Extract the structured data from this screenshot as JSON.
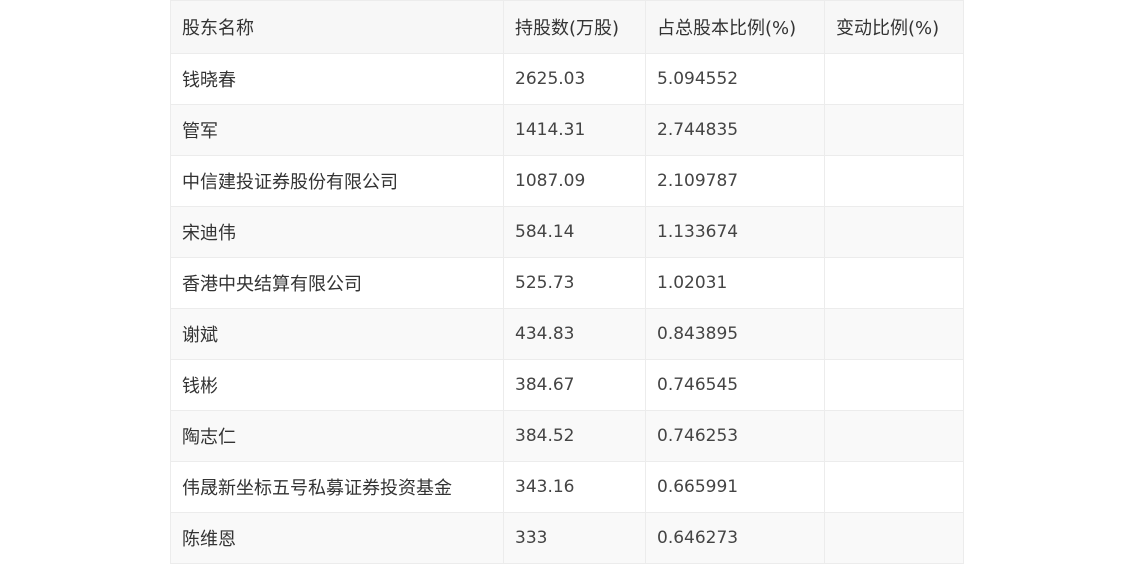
{
  "table": {
    "headers": [
      "股东名称",
      "持股数(万股)",
      "占总股本比例(%)",
      "变动比例(%)"
    ],
    "rows": [
      {
        "name": "钱晓春",
        "shares": "2625.03",
        "ratio": "5.094552",
        "change": ""
      },
      {
        "name": "管军",
        "shares": "1414.31",
        "ratio": "2.744835",
        "change": ""
      },
      {
        "name": "中信建投证券股份有限公司",
        "shares": "1087.09",
        "ratio": "2.109787",
        "change": ""
      },
      {
        "name": "宋迪伟",
        "shares": "584.14",
        "ratio": "1.133674",
        "change": ""
      },
      {
        "name": "香港中央结算有限公司",
        "shares": "525.73",
        "ratio": "1.02031",
        "change": ""
      },
      {
        "name": "谢斌",
        "shares": "434.83",
        "ratio": "0.843895",
        "change": ""
      },
      {
        "name": "钱彬",
        "shares": "384.67",
        "ratio": "0.746545",
        "change": ""
      },
      {
        "name": "陶志仁",
        "shares": "384.52",
        "ratio": "0.746253",
        "change": ""
      },
      {
        "name": "伟晟新坐标五号私募证券投资基金",
        "shares": "343.16",
        "ratio": "0.665991",
        "change": ""
      },
      {
        "name": "陈维恩",
        "shares": "333",
        "ratio": "0.646273",
        "change": ""
      }
    ]
  }
}
